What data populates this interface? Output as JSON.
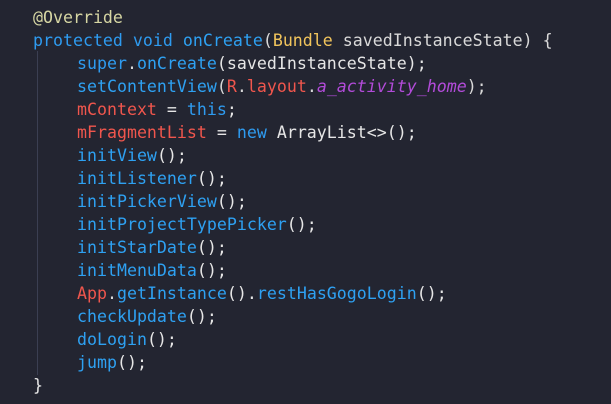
{
  "code": {
    "l1": {
      "annotation": "@Override"
    },
    "l2": {
      "kw1": "protected",
      "kw2": "void",
      "fn": "onCreate",
      "p1": "(",
      "type": "Bundle",
      "param": " savedInstanceState",
      "p2": ") {"
    },
    "l3": {
      "kw": "super",
      "dot": ".",
      "fn": "onCreate",
      "rest": "(savedInstanceState);"
    },
    "l4": {
      "fn": "setContentView",
      "p1": "(",
      "cls": "R",
      "dot1": ".",
      "field": "layout",
      "dot2": ".",
      "res": "a_activity_home",
      "p2": ");"
    },
    "l5": {
      "var": "mContext",
      "eq": " = ",
      "kw": "this",
      "end": ";"
    },
    "l6": {
      "var": "mFragmentList",
      "eq": " = ",
      "kw": "new",
      "rest": " ArrayList<>();"
    },
    "l7": {
      "fn": "initView",
      "rest": "();"
    },
    "l8": {
      "fn": "initListener",
      "rest": "();"
    },
    "l9": {
      "fn": "initPickerView",
      "rest": "();"
    },
    "l10": {
      "fn": "initProjectTypePicker",
      "rest": "();"
    },
    "l11": {
      "fn": "initStarDate",
      "rest": "();"
    },
    "l12": {
      "fn": "initMenuData",
      "rest": "();"
    },
    "l13": {
      "cls": "App",
      "dot1": ".",
      "fn1": "getInstance",
      "mid": "().",
      "fn2": "restHasGogoLogin",
      "rest": "();"
    },
    "l14": {
      "fn": "checkUpdate",
      "rest": "();"
    },
    "l15": {
      "fn": "doLogin",
      "rest": "();"
    },
    "l16": {
      "fn": "jump",
      "rest": "();"
    },
    "l17": {
      "brace": "}"
    }
  },
  "colors": {
    "background": "#232531",
    "keyword": "#2e9bf0",
    "function": "#2ea1f2",
    "type": "#f2c55c",
    "annotation": "#d6d6a3",
    "class_field": "#f0564d",
    "resource_italic": "#b24bd9",
    "plain": "#e6e6e6"
  }
}
